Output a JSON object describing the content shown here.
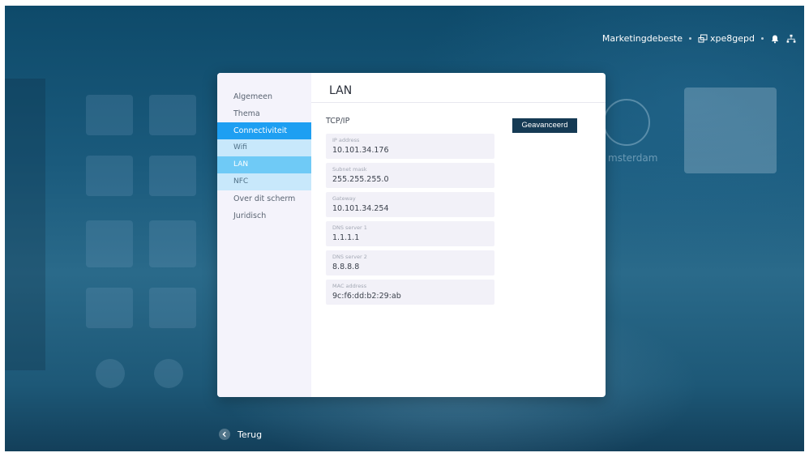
{
  "topbar": {
    "user": "Marketingdebeste",
    "device": "xpe8gepd"
  },
  "background": {
    "clock_city": "msterdam"
  },
  "sidebar": {
    "items": [
      {
        "label": "Algemeen"
      },
      {
        "label": "Thema"
      },
      {
        "label": "Connectiviteit"
      },
      {
        "label": "Wifi"
      },
      {
        "label": "LAN"
      },
      {
        "label": "NFC"
      },
      {
        "label": "Over dit scherm"
      },
      {
        "label": "Juridisch"
      }
    ]
  },
  "content": {
    "title": "LAN",
    "section": "TCP/IP",
    "advanced_button": "Geavanceerd",
    "fields": [
      {
        "label": "IP address",
        "value": "10.101.34.176"
      },
      {
        "label": "Subnet mask",
        "value": "255.255.255.0"
      },
      {
        "label": "Gateway",
        "value": "10.101.34.254"
      },
      {
        "label": "DNS server 1",
        "value": "1.1.1.1"
      },
      {
        "label": "DNS server 2",
        "value": "8.8.8.8"
      },
      {
        "label": "MAC address",
        "value": "9c:f6:dd:b2:29:ab"
      }
    ]
  },
  "footer": {
    "back_label": "Terug"
  },
  "icons": {
    "device": "device-screen-icon",
    "notifications": "bell-icon",
    "network": "network-icon",
    "back": "chevron-left-icon"
  },
  "colors": {
    "accent": "#1e9ff2",
    "sub_active": "#6fcaf6",
    "sub_group": "#c8e8fb",
    "button": "#153a54"
  }
}
